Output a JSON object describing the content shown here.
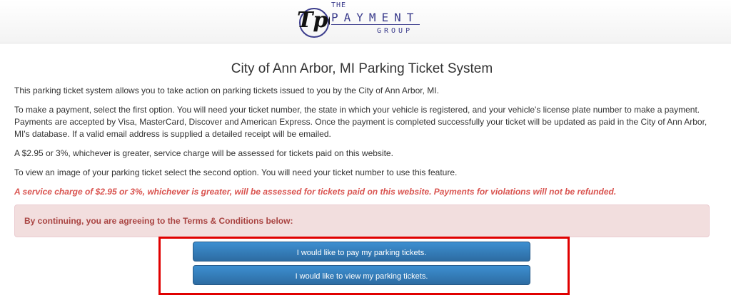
{
  "header": {
    "logo": {
      "mark": "TpG",
      "the": "THE",
      "payment": "PAYMENT",
      "group": "GROUP"
    }
  },
  "main": {
    "title": "City of Ann Arbor, MI Parking Ticket System",
    "paragraphs": [
      "This parking ticket system allows you to take action on parking tickets issued to you by the City of Ann Arbor, MI.",
      "To make a payment, select the first option. You will need your ticket number, the state in which your vehicle is registered, and your vehicle's license plate number to make a payment. Payments are accepted by Visa, MasterCard, Discover and American Express. Once the payment is completed successfully your ticket will be updated as paid in the City of Ann Arbor, MI's database. If a valid email address is supplied a detailed receipt will be emailed.",
      "A $2.95 or 3%, whichever is greater, service charge will be assessed for tickets paid on this website.",
      "To view an image of your parking ticket select the second option. You will need your ticket number to use this feature."
    ],
    "warning": "A service charge of $2.95 or 3%, whichever is greater, will be assessed for tickets paid on this website. Payments for violations will not be refunded.",
    "alert": "By continuing, you are agreeing to the Terms & Conditions below:"
  },
  "actions": {
    "pay_label": "I would like to pay my parking tickets.",
    "view_label": "I would like to view my parking tickets."
  },
  "colors": {
    "logo": "#3b3c8c",
    "warning": "#d9534f",
    "alert_bg": "#f2dede",
    "alert_text": "#a94442",
    "button": "#337ab7",
    "highlight": "#e00000"
  }
}
